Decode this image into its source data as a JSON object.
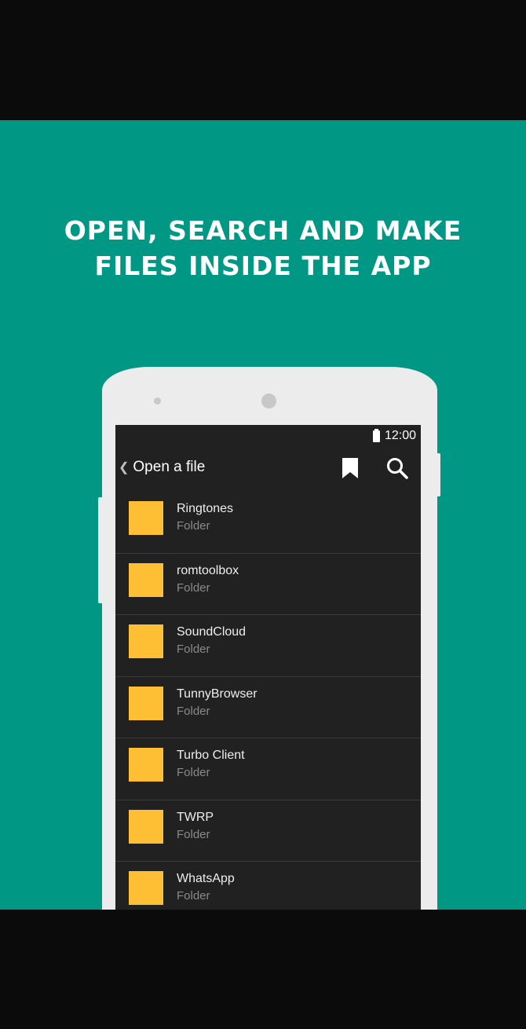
{
  "headline": {
    "line1": "OPEN, SEARCH AND MAKE",
    "line2": "FILES INSIDE THE APP"
  },
  "colors": {
    "background": "#009885",
    "folder": "#ffbf35",
    "screen": "#212121"
  },
  "status_bar": {
    "time": "12:00",
    "battery_icon": "battery-full-icon"
  },
  "app_bar": {
    "back_icon": "chevron-left-icon",
    "title": "Open a file",
    "bookmark_icon": "bookmark-icon",
    "search_icon": "search-icon"
  },
  "files": [
    {
      "name": "Ringtones",
      "type": "Folder"
    },
    {
      "name": "romtoolbox",
      "type": "Folder"
    },
    {
      "name": "SoundCloud",
      "type": "Folder"
    },
    {
      "name": "TunnyBrowser",
      "type": "Folder"
    },
    {
      "name": "Turbo Client",
      "type": "Folder"
    },
    {
      "name": "TWRP",
      "type": "Folder"
    },
    {
      "name": "WhatsApp",
      "type": "Folder"
    }
  ]
}
